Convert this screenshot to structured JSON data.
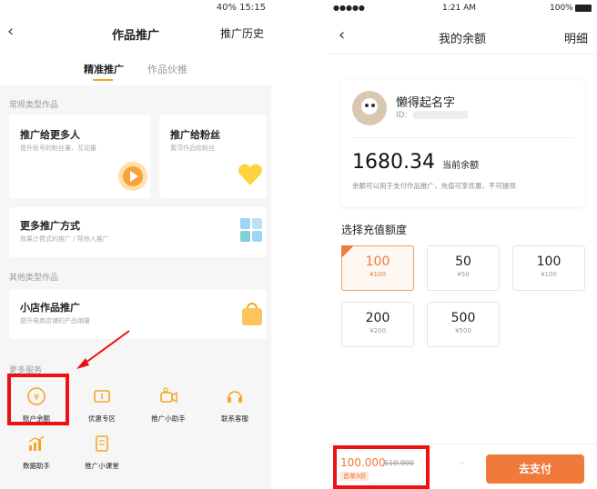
{
  "left": {
    "status_bar": "40% 15:15",
    "nav": {
      "back_icon": "chevron-left-icon",
      "title": "作品推广",
      "history": "推广历史"
    },
    "tabs": [
      {
        "label": "精准推广"
      },
      {
        "label": "作品伙推"
      }
    ],
    "sections": {
      "common": "常规类型作品",
      "other": "其他类型作品",
      "more_services": "更多服务"
    },
    "cards": {
      "more_people": {
        "title": "推广给更多人",
        "subtitle": "提升账号的粉丝量、互动量"
      },
      "fans": {
        "title": "推广给粉丝",
        "subtitle": "置顶作品给粉丝"
      },
      "more_methods": {
        "title": "更多推广方式",
        "subtitle": "效果计费式的推广 / 帮他人推广"
      },
      "shop": {
        "title": "小店作品推广",
        "subtitle": "提升电商店铺的产品销量"
      }
    },
    "services": [
      {
        "label": "账户余额"
      },
      {
        "label": "优惠专区"
      },
      {
        "label": "推广小助手"
      },
      {
        "label": "联系客服"
      },
      {
        "label": "数据助手"
      },
      {
        "label": "推广小课堂"
      }
    ]
  },
  "right": {
    "status": {
      "carrier": "●●●●● ",
      "time": "1:21 AM",
      "battery": "100%"
    },
    "nav": {
      "title": "我的余额",
      "detail": "明细"
    },
    "profile": {
      "name": "懒得起名字",
      "id_label": "ID:"
    },
    "balance": {
      "amount": "1680.34",
      "label": "当前余额",
      "note": "余额可以用于支付作品推广，充值可享优惠，不可提现"
    },
    "recharge_title": "选择充值额度",
    "options": [
      {
        "big": "100",
        "small": "¥100"
      },
      {
        "big": "50",
        "small": "¥50"
      },
      {
        "big": "100",
        "small": "¥100"
      },
      {
        "big": "200",
        "small": "¥200"
      },
      {
        "big": "500",
        "small": "¥500"
      }
    ],
    "footer": {
      "price": "100.000",
      "old_price": "110.000",
      "tag": "首单9折",
      "pay": "去支付"
    }
  },
  "colors": {
    "accent": "#f07a3a",
    "highlight": "#ee1111",
    "tab_underline": "#f5a623"
  }
}
